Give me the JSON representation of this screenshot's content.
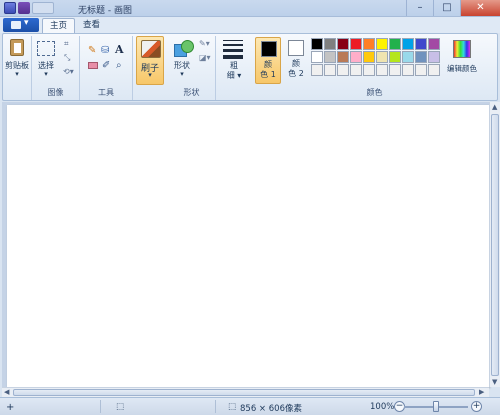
{
  "window": {
    "title": "无标题 - 画图"
  },
  "tabs": [
    {
      "label": "主页"
    },
    {
      "label": "查看"
    }
  ],
  "ribbon": {
    "clipboard": {
      "label": "剪贴板"
    },
    "image": {
      "group_label": "图像",
      "select_label": "选择"
    },
    "tools": {
      "group_label": "工具",
      "text_icon_glyph": "A"
    },
    "brushes": {
      "label": "刷子"
    },
    "shapes": {
      "group_label": "形状",
      "shapes_label": "形状"
    },
    "size": {
      "label_line1": "粗",
      "label_line2": "细"
    },
    "colors": {
      "group_label": "颜色",
      "color1_label_line1": "颜",
      "color1_label_line2": "色 1",
      "color2_label_line1": "颜",
      "color2_label_line2": "色 2",
      "color1_value": "#000000",
      "color2_value": "#ffffff",
      "edit_colors_label": "编辑颜色",
      "palette_row1": [
        "#000000",
        "#7f7f7f",
        "#880015",
        "#ed1c24",
        "#ff7f27",
        "#fff200",
        "#22b14c",
        "#00a2e8",
        "#3f48cc",
        "#a349a4"
      ],
      "palette_row2": [
        "#ffffff",
        "#c3c3c3",
        "#b97a57",
        "#ffaec9",
        "#ffc90e",
        "#efe4b0",
        "#b5e61d",
        "#99d9ea",
        "#7092be",
        "#c8bfe7"
      ],
      "palette_row3": [
        "#f0f0f0",
        "#f0f0f0",
        "#f0f0f0",
        "#f0f0f0",
        "#f0f0f0",
        "#f0f0f0",
        "#f0f0f0",
        "#f0f0f0",
        "#f0f0f0",
        "#f0f0f0"
      ]
    }
  },
  "statusbar": {
    "canvas_size": "856 × 606像素",
    "zoom": "100%",
    "zoom_minus": "−",
    "zoom_plus": "+"
  },
  "colors": {
    "accent_active": "#f7c769",
    "ribbon_bg": "#f6f9fd",
    "file_button": "#1b4fa8"
  }
}
